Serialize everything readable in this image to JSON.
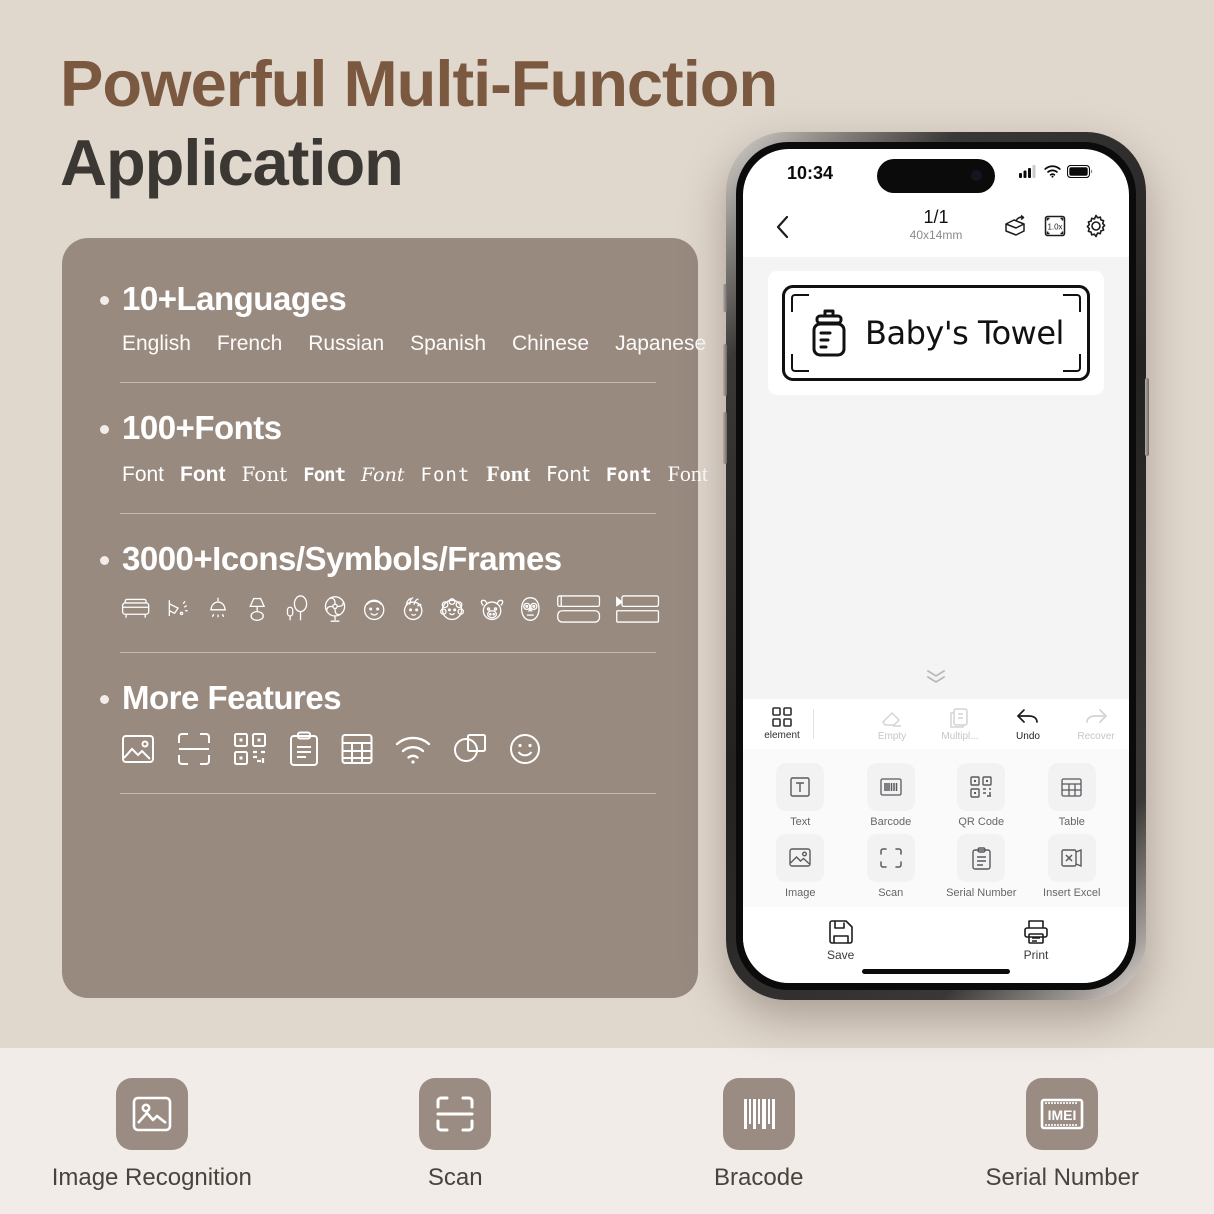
{
  "headline": {
    "line1": "Powerful Multi-Function",
    "line2": "Application",
    "color1": "#7b5840",
    "color2": "#3b3733"
  },
  "card": {
    "bg": "#998a80",
    "features": [
      {
        "title": "10+Languages",
        "languages": [
          "English",
          "French",
          "Russian",
          "Spanish",
          "Chinese",
          "Japanese"
        ]
      },
      {
        "title": "100+Fonts",
        "samples": [
          "Font",
          "Font",
          "Font",
          "Font",
          "Font",
          "Font",
          "Font",
          "Font",
          "Font",
          "Font"
        ]
      },
      {
        "title": "3000+Icons/Symbols/Frames",
        "icons": [
          "sofa-icon",
          "wall-lamp-icon",
          "pendant-light-icon",
          "table-lamp-icon",
          "floor-lamp-icon",
          "fan-icon",
          "boy-face-icon",
          "girl-face-icon",
          "sheep-icon",
          "cow-icon",
          "owl-icon",
          "frame-double-icon",
          "frame-arrow-icon"
        ]
      },
      {
        "title": "More Features",
        "icons": [
          "image-icon",
          "scan-icon",
          "qrcode-icon",
          "clipboard-icon",
          "table-icon",
          "wifi-icon",
          "shapes-icon",
          "smiley-icon"
        ]
      }
    ]
  },
  "phone": {
    "status": {
      "time": "10:34",
      "signal": "cellular-icon",
      "wifi": "wifi-icon",
      "battery": "battery-icon"
    },
    "nav": {
      "back": "back-chevron-icon",
      "page": "1/1",
      "size": "40x14mm",
      "actions": [
        "rotate-icon",
        "zoom-1x-icon",
        "settings-gear-icon"
      ],
      "zoom_level": "1.0x"
    },
    "canvas": {
      "label_text": "Baby's Towel",
      "label_icon": "baby-bottle-icon",
      "collapse": "double-chevron-down-icon"
    },
    "toolbar": {
      "element_label": "element",
      "element_icon": "grid-icon",
      "actions": [
        {
          "label": "Empty",
          "icon": "eraser-icon",
          "enabled": false
        },
        {
          "label": "Multipl...",
          "icon": "multiple-icon",
          "enabled": false
        },
        {
          "label": "Undo",
          "icon": "undo-icon",
          "enabled": true
        },
        {
          "label": "Recover",
          "icon": "redo-icon",
          "enabled": false
        }
      ]
    },
    "panel": {
      "items": [
        {
          "label": "Text",
          "icon": "text-t-icon"
        },
        {
          "label": "Barcode",
          "icon": "barcode-icon"
        },
        {
          "label": "QR Code",
          "icon": "qrcode-icon"
        },
        {
          "label": "Table",
          "icon": "table-icon"
        },
        {
          "label": "Image",
          "icon": "image-icon"
        },
        {
          "label": "Scan",
          "icon": "scan-icon"
        },
        {
          "label": "Serial Number",
          "icon": "clipboard-icon"
        },
        {
          "label": "Insert Excel",
          "icon": "excel-icon"
        }
      ],
      "page_dots": 2,
      "active_dot": 0
    },
    "bottombar": {
      "save_label": "Save",
      "save_icon": "floppy-save-icon",
      "print_label": "Print",
      "print_icon": "printer-icon"
    }
  },
  "strip": {
    "items": [
      {
        "label": "Image Recognition",
        "icon": "image-recognition-icon"
      },
      {
        "label": "Scan",
        "icon": "scan-icon"
      },
      {
        "label": "Bracode",
        "icon": "barcode-icon"
      },
      {
        "label": "Serial Number",
        "icon": "imei-icon"
      }
    ],
    "tile_color": "#9b8c83",
    "label_color": "#4a423c"
  }
}
